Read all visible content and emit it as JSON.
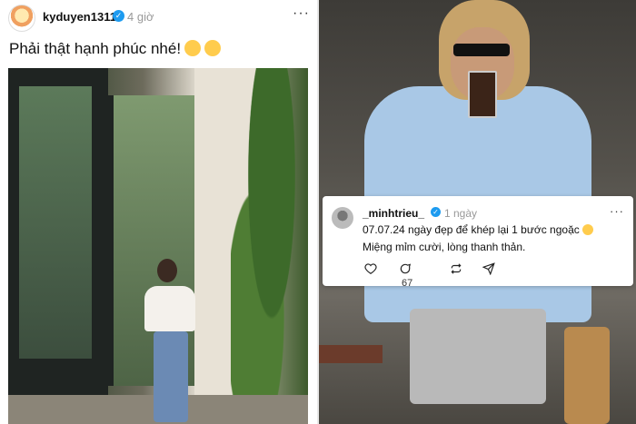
{
  "left_post": {
    "username": "kyduyen1311",
    "verified_badge": "✓",
    "time": "4 giờ",
    "more": "···",
    "caption": "Phải thật hạnh phúc nhé!"
  },
  "right_card": {
    "username": "_minhtrieu_",
    "verified_badge": "✓",
    "time": "1 ngày",
    "more": "···",
    "line1": "07.07.24 ngày đẹp để khép lại 1 bước ngoặc",
    "line2": "Miệng mỉm cười, lòng thanh thản.",
    "actions": {
      "reply_count": "67"
    }
  },
  "icons": [
    "verified-badge-icon",
    "more-icon",
    "heart-icon",
    "comment-icon",
    "repost-icon",
    "share-icon"
  ],
  "colors": {
    "verified": "#1d9bf0"
  }
}
